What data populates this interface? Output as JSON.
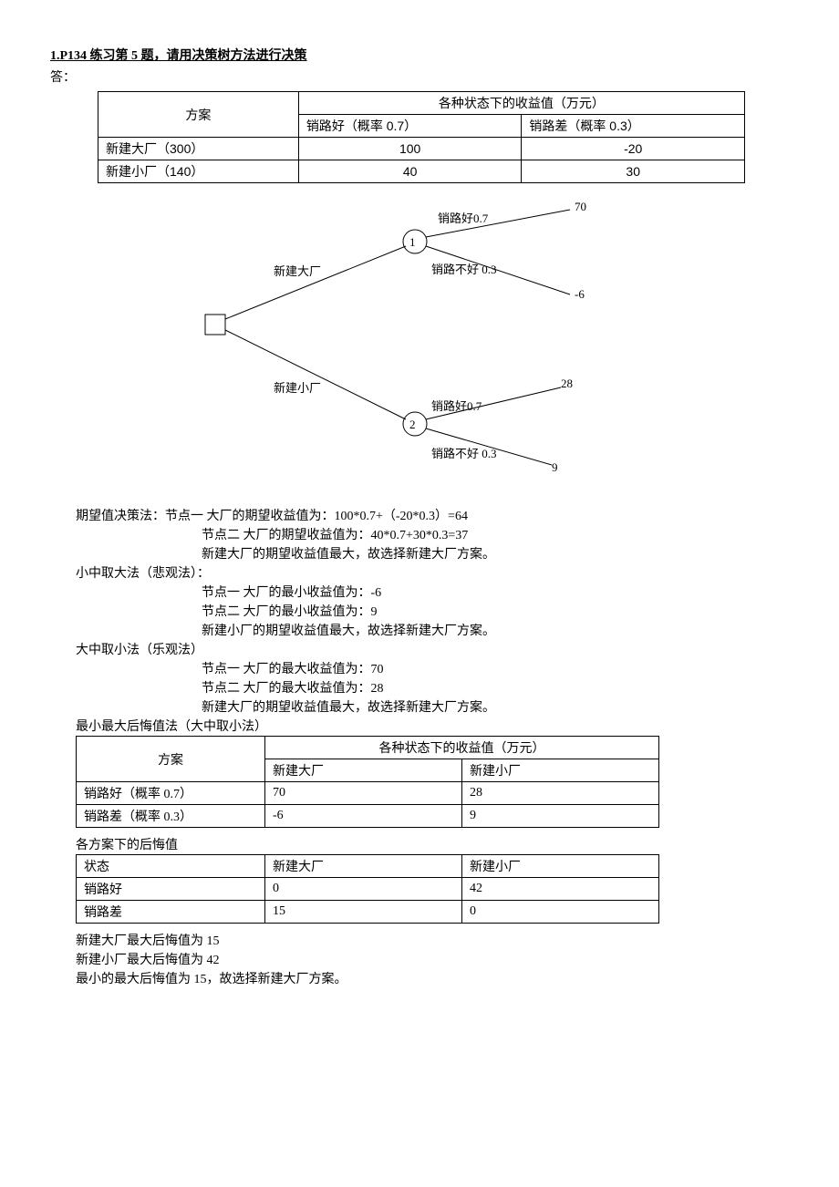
{
  "title": "1.P134 练习第 5 题，请用决策树方法进行决策",
  "answer_label": "答：",
  "table1": {
    "header_plan": "方案",
    "header_group": "各种状态下的收益值（万元）",
    "col_good": "销路好（概率 0.7）",
    "col_bad": "销路差（概率 0.3）",
    "rows": [
      {
        "plan": "新建大厂（300）",
        "good": "100",
        "bad": "-20"
      },
      {
        "plan": "新建小厂（140）",
        "good": "40",
        "bad": "30"
      }
    ]
  },
  "diagram": {
    "big": "新建大厂",
    "small": "新建小厂",
    "good07": "销路好0.7",
    "bad03": "销路不好 0.3",
    "bad03b": "销路不好 0.3",
    "v70": "70",
    "vneg6": "-6",
    "v28": "28",
    "v9": "9",
    "n1": "1",
    "n2": "2"
  },
  "expected": {
    "head": "期望值决策法：节点一 大厂的期望收益值为：100*0.7+（-20*0.3）=64",
    "l2": "节点二 大厂的期望收益值为：40*0.7+30*0.3=37",
    "l3": "新建大厂的期望收益值最大，故选择新建大厂方案。"
  },
  "pessimistic": {
    "head": "小中取大法（悲观法）：",
    "l1": "节点一 大厂的最小收益值为：-6",
    "l2": "节点二 大厂的最小收益值为：9",
    "l3": "新建小厂的期望收益值最大，故选择新建大厂方案。"
  },
  "optimistic": {
    "head": "大中取小法（乐观法）",
    "l1": "节点一 大厂的最大收益值为：70",
    "l2": "节点二 大厂的最大收益值为：28",
    "l3": "新建大厂的期望收益值最大，故选择新建大厂方案。"
  },
  "regret_title": "最小最大后悔值法（大中取小法）",
  "table2": {
    "header_plan": "方案",
    "header_group": "各种状态下的收益值（万元）",
    "col_big": "新建大厂",
    "col_small": "新建小厂",
    "rows": [
      {
        "a": "销路好（概率 0.7）",
        "b": "70",
        "c": "28"
      },
      {
        "a": "销路差（概率 0.3）",
        "b": "-6",
        "c": "9"
      }
    ]
  },
  "regret_sub": "各方案下的后悔值",
  "table3": {
    "col_state": "状态",
    "col_big": "新建大厂",
    "col_small": "新建小厂",
    "rows": [
      {
        "a": "销路好",
        "b": "0",
        "c": "42"
      },
      {
        "a": "销路差",
        "b": "15",
        "c": "0"
      }
    ]
  },
  "conclusion": {
    "l1": "新建大厂最大后悔值为 15",
    "l2": "新建小厂最大后悔值为 42",
    "l3": "最小的最大后悔值为 15，故选择新建大厂方案。"
  }
}
